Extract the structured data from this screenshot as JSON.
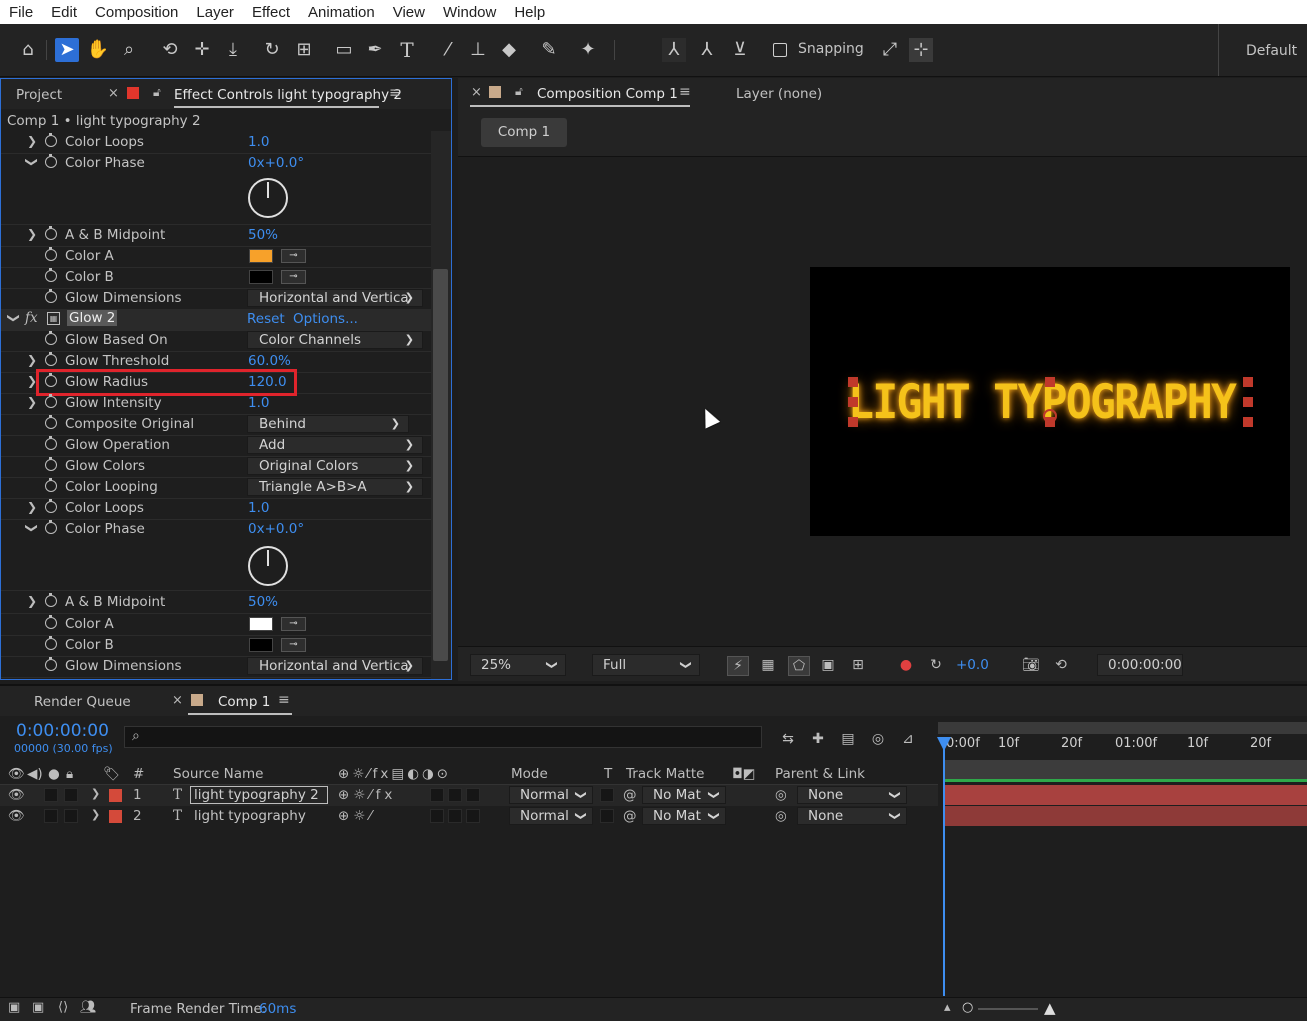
{
  "menu": [
    "File",
    "Edit",
    "Composition",
    "Layer",
    "Effect",
    "Animation",
    "View",
    "Window",
    "Help"
  ],
  "toolbar": {
    "snapping_label": "Snapping",
    "workspace": "Default"
  },
  "left_panel": {
    "tab_project": "Project",
    "tab_effect_controls": "Effect Controls light typography 2",
    "breadcrumb": "Comp 1 • light typography 2",
    "rows": [
      {
        "name": "Color Loops",
        "value": "1.0"
      },
      {
        "name": "Color Phase",
        "value": "0x+0.0°"
      },
      {
        "name": "A & B Midpoint",
        "value": "50%"
      },
      {
        "name": "Color A",
        "color": "#f7a12a"
      },
      {
        "name": "Color B",
        "color": "#000000"
      },
      {
        "name": "Glow Dimensions",
        "dropdown": "Horizontal and Vertica"
      },
      {
        "name": "Glow 2",
        "reset": "Reset",
        "options": "Options..."
      },
      {
        "name": "Glow Based On",
        "dropdown": "Color Channels"
      },
      {
        "name": "Glow Threshold",
        "value": "60.0%"
      },
      {
        "name": "Glow Radius",
        "value": "120.0"
      },
      {
        "name": "Glow Intensity",
        "value": "1.0"
      },
      {
        "name": "Composite Original",
        "dropdown": "Behind"
      },
      {
        "name": "Glow Operation",
        "dropdown": "Add"
      },
      {
        "name": "Glow Colors",
        "dropdown": "Original Colors"
      },
      {
        "name": "Color Looping",
        "dropdown": "Triangle A>B>A"
      },
      {
        "name": "Color Loops",
        "value": "1.0"
      },
      {
        "name": "Color Phase",
        "value": "0x+0.0°"
      },
      {
        "name": "A & B Midpoint",
        "value": "50%"
      },
      {
        "name": "Color A",
        "color": "#ffffff"
      },
      {
        "name": "Color B",
        "color": "#000000"
      },
      {
        "name": "Glow Dimensions",
        "dropdown": "Horizontal and Vertica"
      }
    ],
    "highlight_color": "#e0242c"
  },
  "viewer": {
    "tab_composition": "Composition Comp 1",
    "tab_layer": "Layer (none)",
    "comp_chip": "Comp 1",
    "canvas_text": "LIGHT TYPOGRAPHY",
    "text_color": "#f5c21a",
    "zoom": "25%",
    "resolution": "Full",
    "exposure": "+0.0",
    "timecode": "0:00:00:00"
  },
  "timeline": {
    "tab_render_queue": "Render Queue",
    "tab_comp": "Comp 1",
    "timecode": "0:00:00:00",
    "fps": "00000 (30.00 fps)",
    "search_placeholder": "",
    "headers": {
      "num": "#",
      "source_name": "Source Name",
      "mode": "Mode",
      "t": "T",
      "track_matte": "Track Matte",
      "parent": "Parent & Link"
    },
    "layers": [
      {
        "index": "1",
        "name": "light typography 2",
        "mode": "Normal",
        "matte": "No Mat",
        "parent": "None"
      },
      {
        "index": "2",
        "name": "light typography",
        "mode": "Normal",
        "matte": "No Mat",
        "parent": "None"
      }
    ],
    "ruler": [
      "0:00f",
      "10f",
      "20f",
      "01:00f",
      "10f",
      "20f"
    ],
    "layer_bar_color": "#a8413f"
  },
  "status": {
    "label": "Frame Render Time:",
    "value": "60ms"
  }
}
